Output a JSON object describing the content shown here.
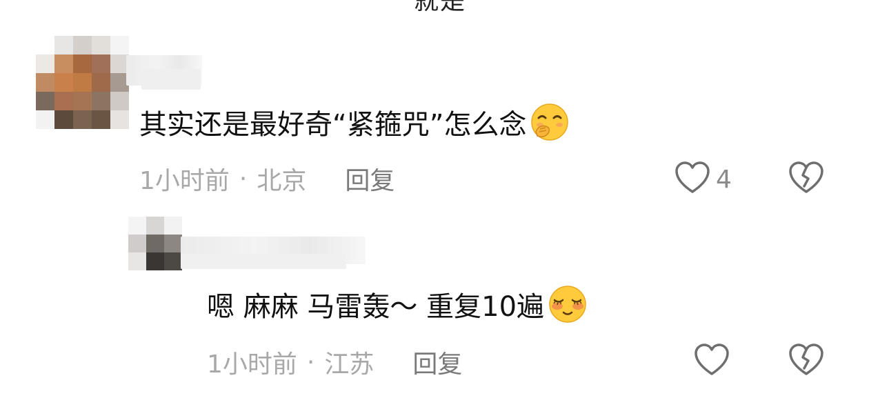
{
  "header": {
    "cut_text": "就是"
  },
  "comments": [
    {
      "text": "其实还是最好奇“紧箍咒”怎么念",
      "emoji": "hand-over-mouth-smiling-emoji",
      "time": "1小时前",
      "separator": "·",
      "location": "北京",
      "reply_label": "回复",
      "like_count": "4"
    },
    {
      "text": "嗯 麻麻 马雷轰～ 重复10遍",
      "emoji": "blushing-smile-emoji",
      "time": "1小时前",
      "separator": "·",
      "location": "江苏",
      "reply_label": "回复",
      "like_count": ""
    }
  ],
  "icons": {
    "like": "heart-outline-icon",
    "dislike": "broken-heart-outline-icon"
  },
  "colors": {
    "text": "#111111",
    "meta": "#a8a8a8",
    "icon": "#6e6e6e"
  }
}
